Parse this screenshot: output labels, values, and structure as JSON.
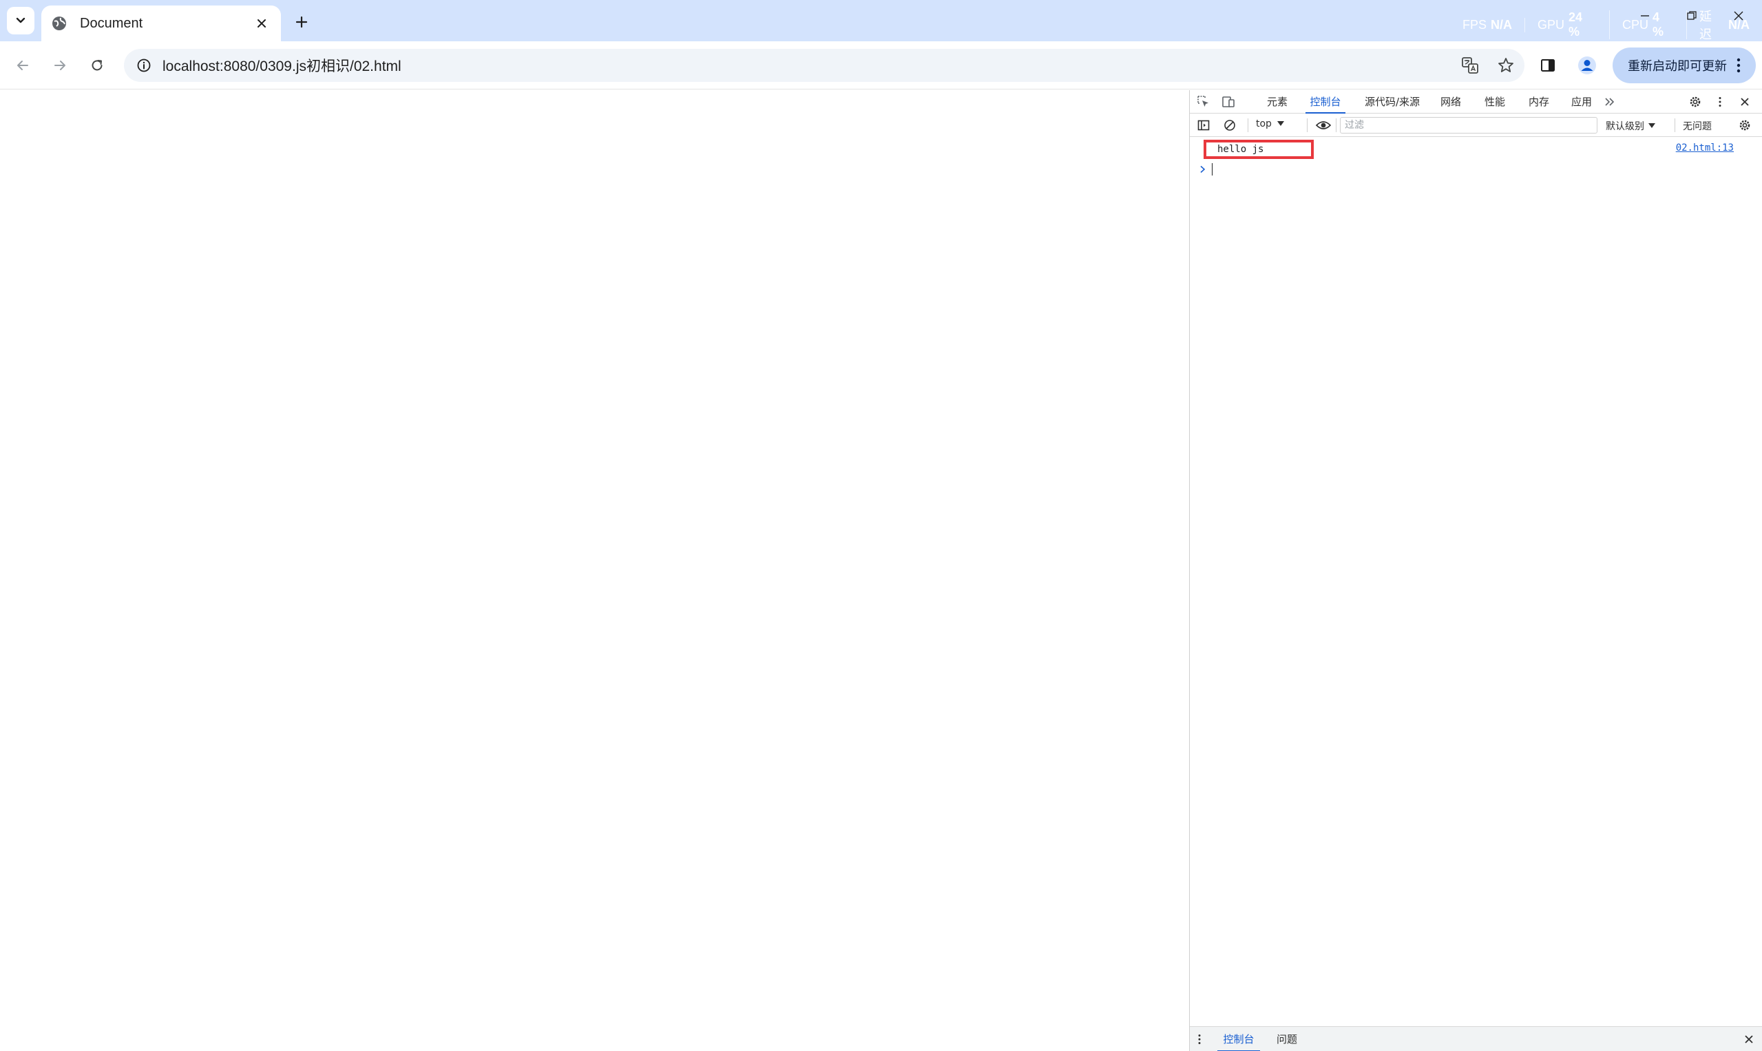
{
  "window": {
    "tab_title": "Document",
    "perf": [
      {
        "label": "FPS",
        "value": "N/A"
      },
      {
        "label": "GPU",
        "value": "24 %"
      },
      {
        "label": "CPU",
        "value": "4 %"
      },
      {
        "label": "延迟",
        "value": "N/A"
      }
    ]
  },
  "toolbar": {
    "url": "localhost:8080/0309.js初相识/02.html",
    "update_label": "重新启动即可更新"
  },
  "devtools": {
    "tabs": [
      "元素",
      "控制台",
      "源代码/来源",
      "网络",
      "性能",
      "内存",
      "应用"
    ],
    "active_tab": "控制台",
    "context": "top",
    "filter_placeholder": "过滤",
    "levels_label": "默认级别",
    "issues_label": "无问题",
    "console": {
      "messages": [
        {
          "text": "hello js",
          "source": "02.html:13"
        }
      ]
    },
    "drawer_tabs": [
      "控制台",
      "问题"
    ]
  },
  "colors": {
    "tabstrip_bg": "#d3e3fd",
    "accent": "#1a5fd1",
    "highlight_box": "#e8383d"
  }
}
